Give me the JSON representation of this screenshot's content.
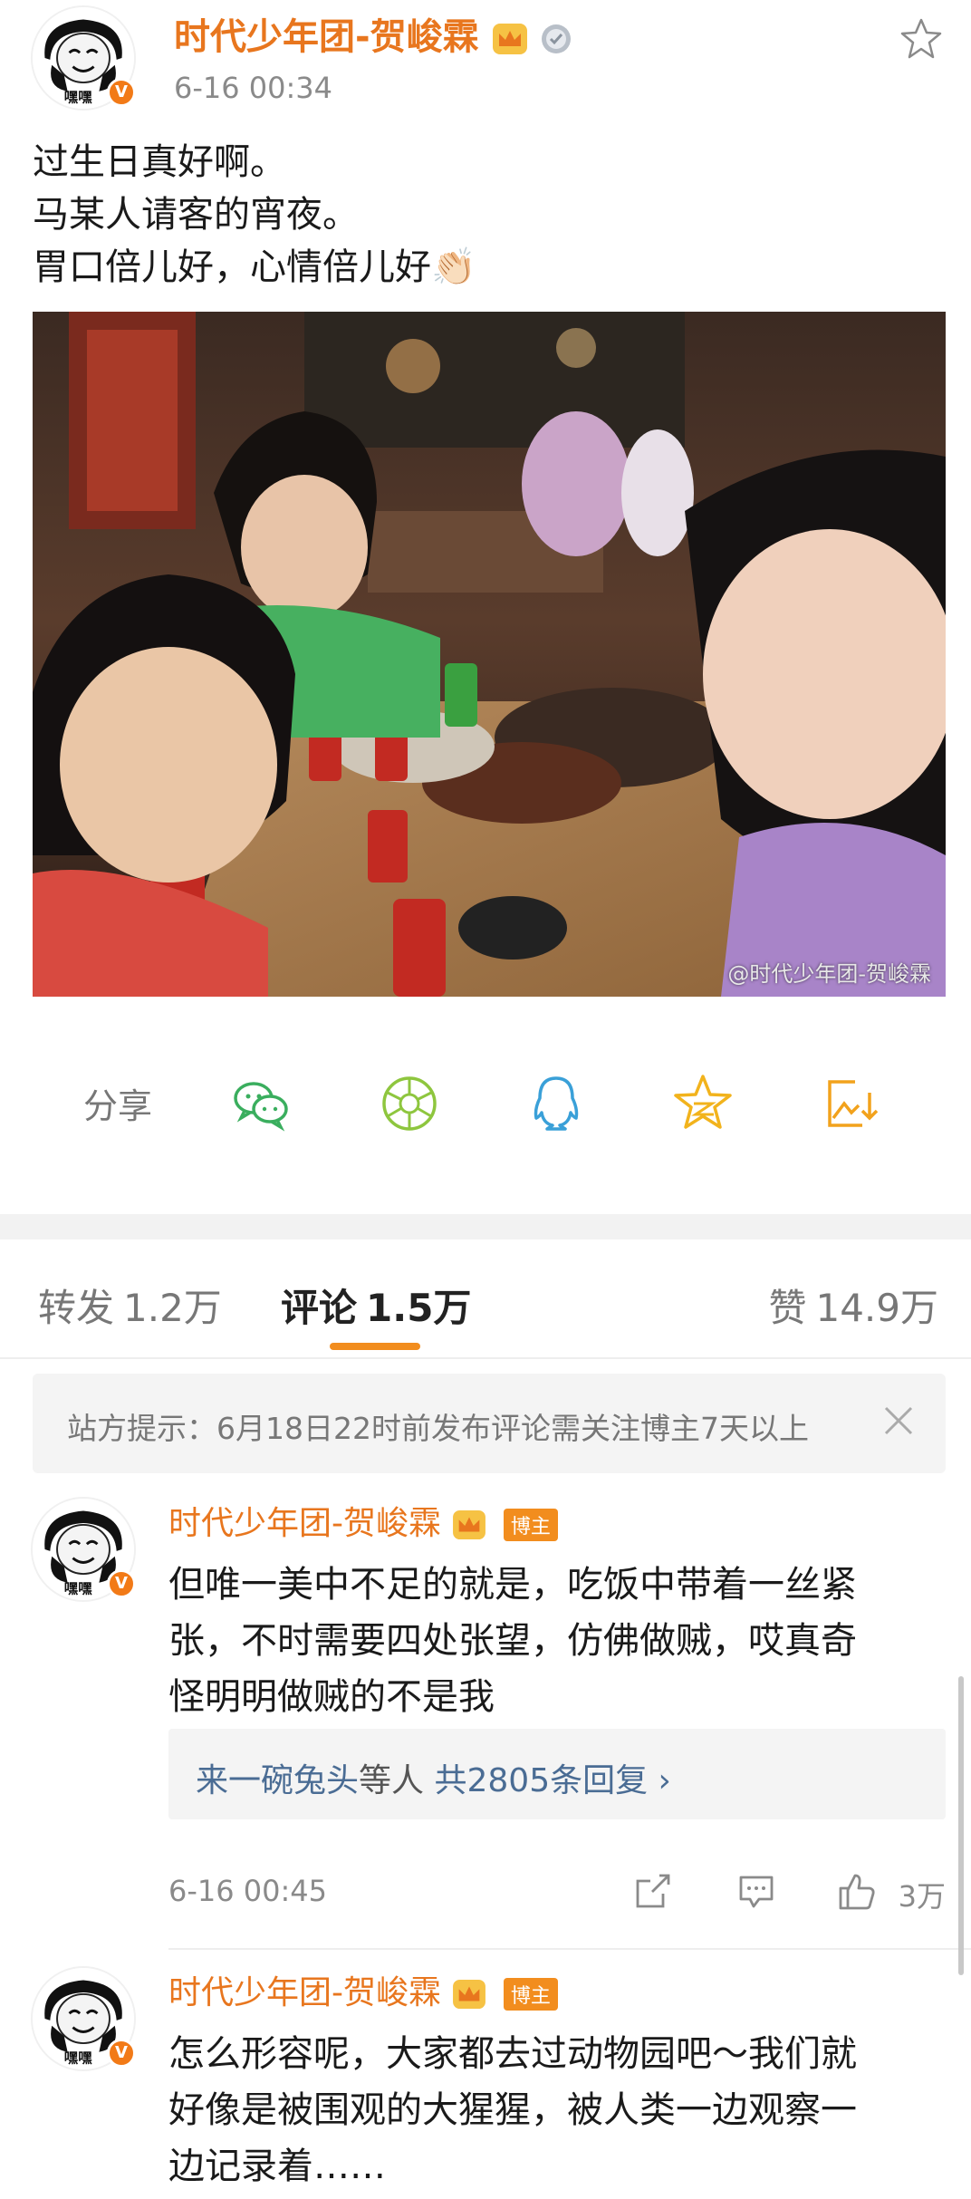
{
  "post": {
    "author": "时代少年团-贺峻霖",
    "time": "6-16 00:34",
    "avatar_text": "嘿嘿",
    "badge_v": "V",
    "lines": [
      "过生日真好啊。",
      "马某人请客的宵夜。",
      "胃口倍儿好，心情倍儿好👏🏻"
    ],
    "watermark": "@时代少年团-贺峻霖"
  },
  "share": {
    "label": "分享",
    "icons": [
      "wechat-icon",
      "moments-icon",
      "qq-icon",
      "qzone-icon",
      "save-image-icon"
    ]
  },
  "tabs": [
    {
      "label": "转发",
      "count": "1.2万",
      "active": false
    },
    {
      "label": "评论",
      "count": "1.5万",
      "active": true
    },
    {
      "label": "赞",
      "count": "14.9万",
      "active": false
    }
  ],
  "notice": "站方提示：6月18日22时前发布评论需关注博主7天以上",
  "comments": [
    {
      "author": "时代少年团-贺峻霖",
      "tag": "博主",
      "lines": [
        "但唯一美中不足的就是，吃饭中带着一丝紧",
        "张，不时需要四处张望，仿佛做贼，哎真奇",
        "怪明明做贼的不是我"
      ],
      "replies": {
        "user": "来一碗兔头",
        "mid": "等人",
        "count": "共2805条回复 ›"
      },
      "time": "6-16 00:45",
      "likes": "3万"
    },
    {
      "author": "时代少年团-贺峻霖",
      "tag": "博主",
      "lines": [
        "怎么形容呢，大家都去过动物园吧～我们就",
        "好像是被围观的大猩猩，被人类一边观察一",
        "边记录着……"
      ]
    }
  ],
  "colors": {
    "accent": "#e8761e",
    "link": "#4a6c94",
    "underline": "#f28d1e"
  }
}
